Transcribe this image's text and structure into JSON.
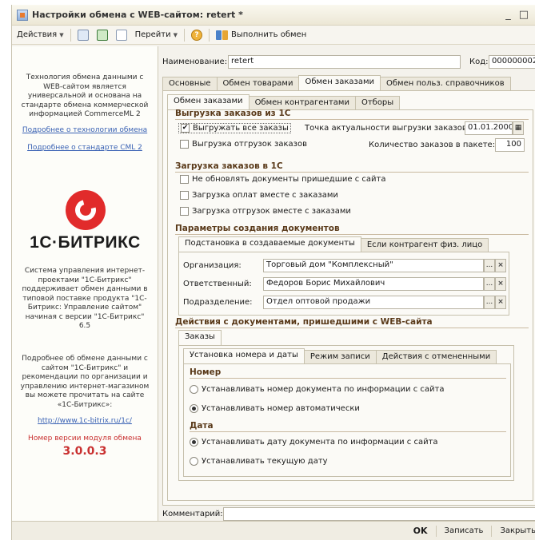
{
  "window": {
    "title": "Настройки обмена с WEB-сайтом: retert *",
    "ctrl_min": "_",
    "ctrl_max": "□"
  },
  "toolbar": {
    "actions": "Действия",
    "goto": "Перейти",
    "help": "?",
    "run_exchange": "Выполнить обмен"
  },
  "left": {
    "intro": "Технология обмена данными с WEB-сайтом является универсальной и основана на стандарте обмена коммерческой информацией CommerceML 2",
    "link_tech": "Подробнее о технологии обмена",
    "link_cml": "Подробнее о стандарте CML 2",
    "brand": "1С·БИТРИКС",
    "about": "Система управления интернет-проектами \"1С-Битрикс\" поддерживает обмен данными в типовой поставке продукта \"1С-Битрикс: Управление сайтом\" начиная с версии \"1С-Битрикс\" 6.5",
    "more": "Подробнее об обмене данными с сайтом \"1С-Битрикс\" и рекомендации по организации и управлению интернет-магазином вы можете прочитать на сайте «1С-Битрикс»:",
    "site_link": "http://www.1c-bitrix.ru/1c/",
    "version_label": "Номер версии модуля обмена",
    "version": "3.0.0.3"
  },
  "header": {
    "name_label": "Наименование:",
    "name_value": "retert",
    "code_label": "Код:",
    "code_value": "000000002"
  },
  "main_tabs": [
    "Основные",
    "Обмен товарами",
    "Обмен заказами",
    "Обмен польз. справочников"
  ],
  "sub_tabs": [
    "Обмен заказами",
    "Обмен контрагентами",
    "Отборы"
  ],
  "export": {
    "title": "Выгрузка заказов из 1С",
    "all_orders": "Выгружать все заказы",
    "all_orders_checked": true,
    "actuality_label": "Точка актуальности выгрузки заказов:",
    "actuality_date": "01.01.2000",
    "shipments": "Выгрузка отгрузок заказов",
    "shipments_checked": false,
    "batch_label": "Количество заказов в пакете:",
    "batch_value": "100"
  },
  "import": {
    "title": "Загрузка заказов в 1С",
    "no_update": "Не обновлять документы пришедшие с сайта",
    "with_payments": "Загрузка оплат вместе с заказами",
    "with_shipments": "Загрузка отгрузок вместе с заказами"
  },
  "doc_params": {
    "title": "Параметры создания документов",
    "tabs": [
      "Подстановка в создаваемые документы",
      "Если контрагент физ. лицо"
    ],
    "org_label": "Организация:",
    "org_value": "Торговый дом \"Комплексный\"",
    "resp_label": "Ответственный:",
    "resp_value": "Федоров Борис Михайлович",
    "dept_label": "Подразделение:",
    "dept_value": "Отдел оптовой продажи",
    "select_btn": "...",
    "clear_btn": "×"
  },
  "web_actions": {
    "title": "Действия с документами, пришедшими с WEB-сайта",
    "orders_tab": "Заказы",
    "tabs": [
      "Установка номера и даты",
      "Режим записи",
      "Действия с отмененными"
    ],
    "number_title": "Номер",
    "number_opt1": "Устанавливать номер документа по информации с сайта",
    "number_opt2": "Устанавливать номер автоматически",
    "number_selected": 2,
    "date_title": "Дата",
    "date_opt1": "Устанавливать дату документа по информации с сайта",
    "date_opt2": "Устанавливать текущую дату",
    "date_selected": 1
  },
  "comment_label": "Комментарий:",
  "bottom": {
    "ok": "OK",
    "save": "Записать",
    "close": "Закрыть"
  }
}
